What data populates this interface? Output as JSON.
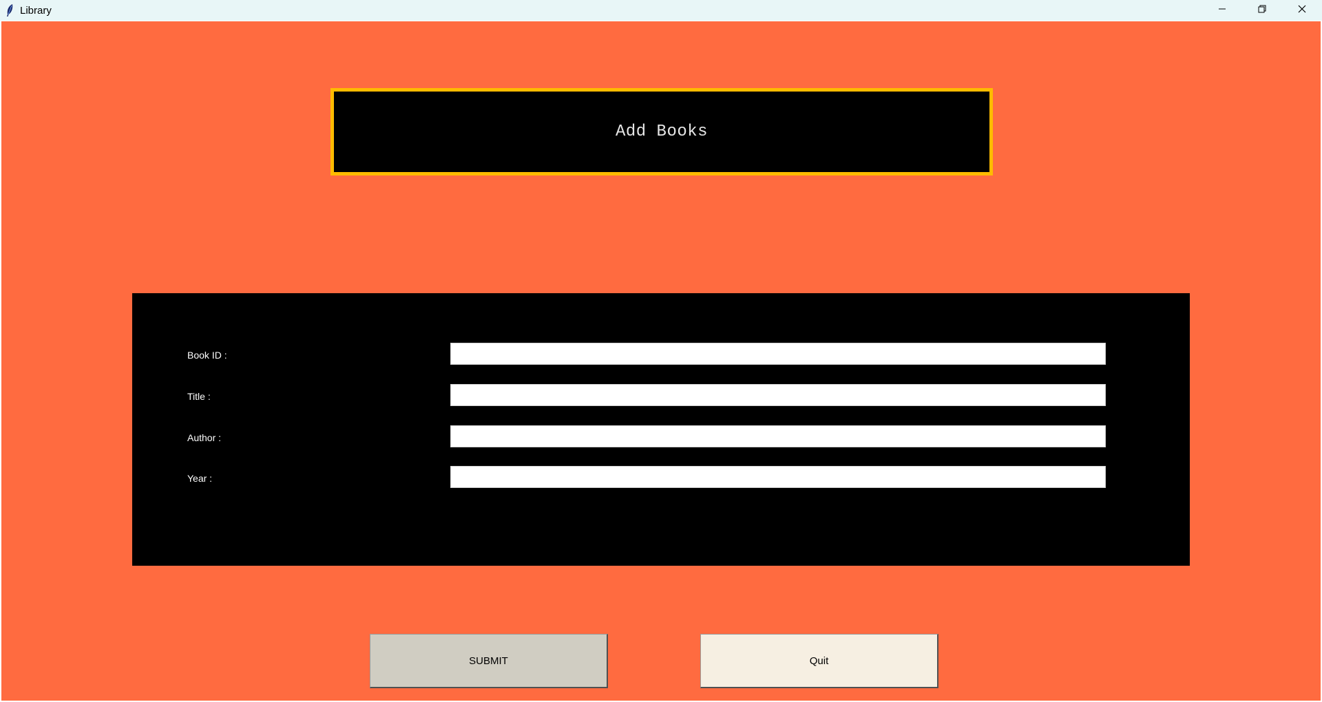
{
  "window": {
    "title": "Library",
    "icon": "feather-icon",
    "controls": [
      "minimize-icon",
      "restore-icon",
      "close-icon"
    ]
  },
  "heading": {
    "text": "Add Books"
  },
  "form": {
    "fields": [
      {
        "label": "Book ID :",
        "value": "",
        "placeholder": ""
      },
      {
        "label": "Title :",
        "value": "",
        "placeholder": ""
      },
      {
        "label": "Author :",
        "value": "",
        "placeholder": ""
      },
      {
        "label": "Year :",
        "value": "",
        "placeholder": ""
      }
    ]
  },
  "buttons": {
    "submit_label": "SUBMIT",
    "quit_label": "Quit"
  },
  "colors": {
    "background": "#ff6b40",
    "heading_border": "#ffbb00",
    "panel": "#000000",
    "submit_button": "#d0cdc2",
    "quit_button": "#f6efe2"
  }
}
